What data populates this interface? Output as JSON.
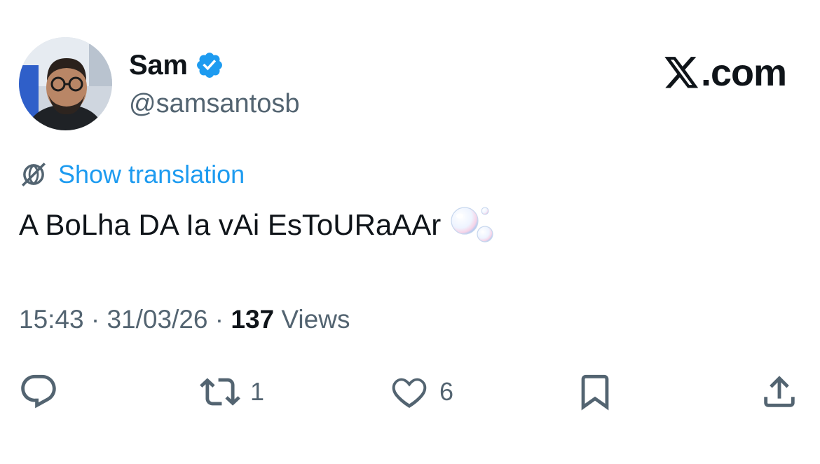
{
  "author": {
    "display_name": "Sam",
    "handle": "@samsantosb",
    "verified": true,
    "avatar_icon": "profile-photo"
  },
  "brand": {
    "text": ".com",
    "icon": "x-logo-icon"
  },
  "translation": {
    "label": "Show translation",
    "icon": "translate-icon"
  },
  "tweet": {
    "text": "A BoLha DA Ia vAi EsToURaAAr",
    "emoji": "bubbles"
  },
  "meta": {
    "time": "15:43",
    "separator": "·",
    "date": "31/03/26",
    "views_count": "137",
    "views_label": "Views"
  },
  "actions": {
    "reply": {
      "count": "",
      "icon": "reply-icon"
    },
    "repost": {
      "count": "1",
      "icon": "repost-icon"
    },
    "like": {
      "count": "6",
      "icon": "heart-icon"
    },
    "bookmark": {
      "count": "",
      "icon": "bookmark-icon"
    },
    "share": {
      "count": "",
      "icon": "share-icon"
    }
  },
  "colors": {
    "accent": "#1d9bf0",
    "text": "#0f1419",
    "secondary": "#536471",
    "background": "#ffffff"
  }
}
